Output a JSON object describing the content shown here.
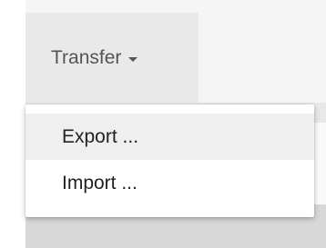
{
  "toolbar": {
    "transfer_label": "Transfer",
    "caret_icon": "caret-down-icon"
  },
  "menu": {
    "items": [
      {
        "label": "Export ..."
      },
      {
        "label": "Import ..."
      }
    ]
  }
}
